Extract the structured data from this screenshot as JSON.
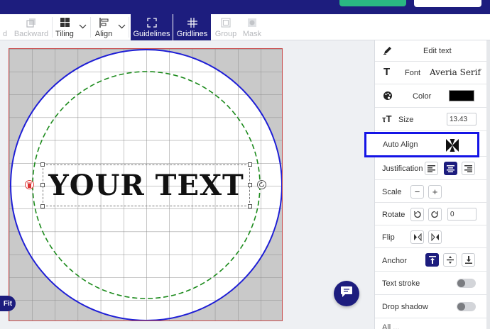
{
  "toolbar": {
    "items": [
      {
        "label": "d",
        "icon": "partial-icon"
      },
      {
        "label": "Backward",
        "icon": "send-backward-icon"
      },
      {
        "label": "Tiling",
        "icon": "tiling-grid-icon"
      },
      {
        "label": "Align",
        "icon": "align-left-icon"
      },
      {
        "label": "Guidelines",
        "icon": "guidelines-icon"
      },
      {
        "label": "Gridlines",
        "icon": "gridlines-icon"
      },
      {
        "label": "Group",
        "icon": "group-icon"
      },
      {
        "label": "Mask",
        "icon": "mask-icon"
      }
    ]
  },
  "canvas": {
    "text": "YOUR TEXT",
    "fit_label": "Fit",
    "colors": {
      "outer_circle": "#1e1ed6",
      "inner_circle": "#1b8a1b",
      "artboard_border": "#c84a4a"
    }
  },
  "panel": {
    "edit_text": "Edit text",
    "font_label": "Font",
    "font_value": "Averia Serif",
    "color_label": "Color",
    "color_value": "#000000",
    "size_label": "Size",
    "size_value": "13.43",
    "auto_align_label": "Auto Align",
    "justification_label": "Justification",
    "scale_label": "Scale",
    "rotate_label": "Rotate",
    "rotate_value": "0",
    "flip_label": "Flip",
    "anchor_label": "Anchor",
    "text_stroke_label": "Text stroke",
    "drop_shadow_label": "Drop shadow",
    "cut_off_label": "All ..."
  }
}
